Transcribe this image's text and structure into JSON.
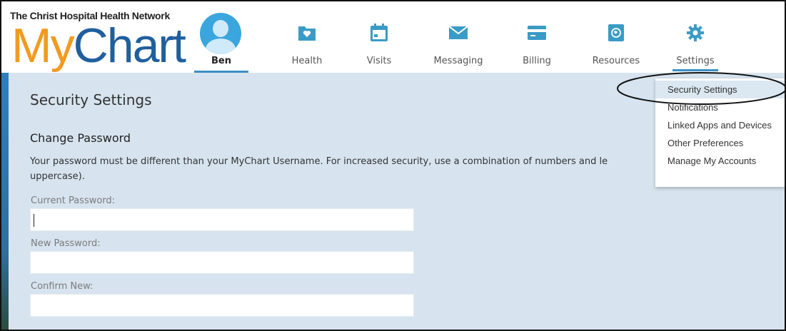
{
  "header": {
    "network_name": "The Christ Hospital Health Network",
    "logo_my": "My",
    "logo_chart": "Chart",
    "user": {
      "name": "Ben",
      "active": true
    },
    "nav": [
      {
        "label": "Health",
        "icon": "heart-folder-icon"
      },
      {
        "label": "Visits",
        "icon": "calendar-icon"
      },
      {
        "label": "Messaging",
        "icon": "envelope-icon"
      },
      {
        "label": "Billing",
        "icon": "credit-card-icon"
      },
      {
        "label": "Resources",
        "icon": "globe-book-icon"
      },
      {
        "label": "Settings",
        "icon": "gear-icon",
        "active": true
      }
    ]
  },
  "main": {
    "page_title": "Security Settings",
    "section_title": "Change Password",
    "description": "Your password must be different than your MyChart Username. For increased security, use a combination of numbers and le",
    "description_line2": "uppercase).",
    "fields": [
      {
        "label": "Current Password:",
        "value": ""
      },
      {
        "label": "New Password:",
        "value": ""
      },
      {
        "label": "Confirm New:",
        "value": ""
      }
    ]
  },
  "settings_menu": {
    "items": [
      {
        "label": "Security Settings",
        "active": true
      },
      {
        "label": "Notifications"
      },
      {
        "label": "Linked Apps and Devices"
      },
      {
        "label": "Other Preferences"
      },
      {
        "label": "Manage My Accounts"
      }
    ]
  },
  "colors": {
    "accent": "#3c8fc3",
    "logo_orange": "#f29a1f",
    "logo_blue": "#1f5f9e",
    "content_bg": "#d7e4ef",
    "icon_teal": "#3b9bc6"
  }
}
